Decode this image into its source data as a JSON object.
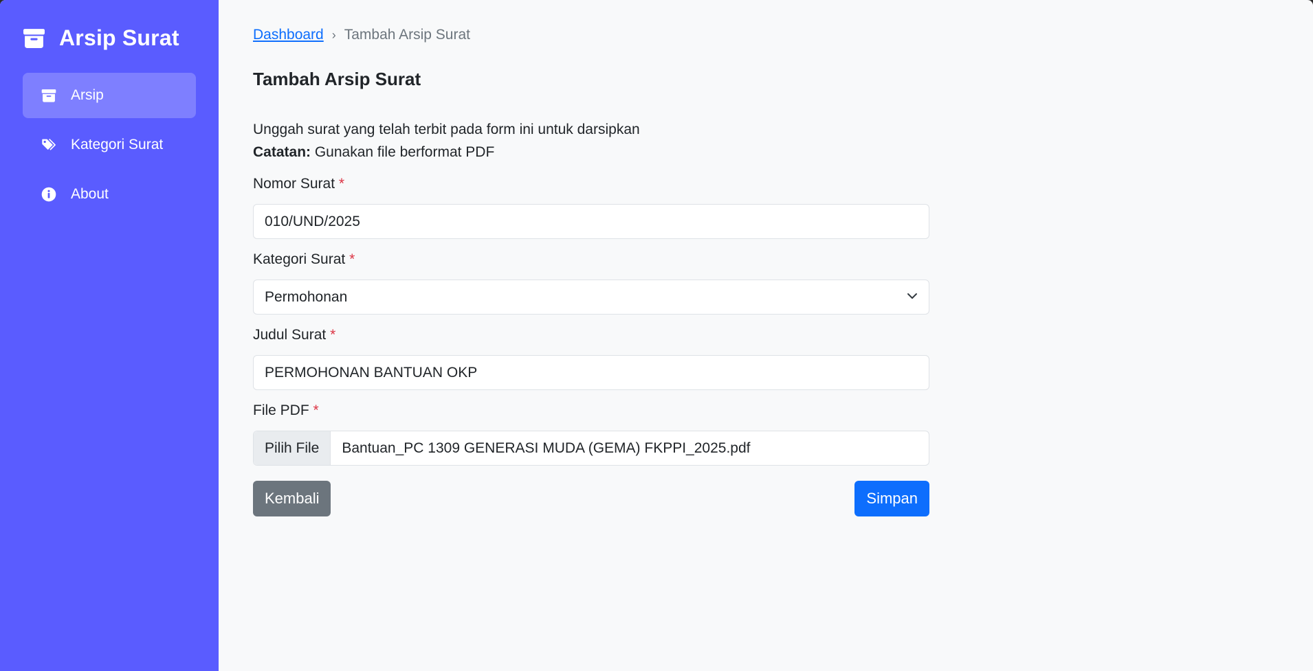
{
  "sidebar": {
    "brand": {
      "title": "Arsip Surat",
      "icon": "archive-icon"
    },
    "items": [
      {
        "label": "Arsip",
        "icon": "archive-icon",
        "active": true
      },
      {
        "label": "Kategori Surat",
        "icon": "tags-icon",
        "active": false
      },
      {
        "label": "About",
        "icon": "info-circle-icon",
        "active": false
      }
    ]
  },
  "breadcrumb": {
    "link": "Dashboard",
    "separator": "›",
    "current": "Tambah Arsip Surat"
  },
  "page": {
    "title": "Tambah Arsip Surat",
    "intro": "Unggah surat yang telah terbit pada form ini untuk darsipkan",
    "note_label": "Catatan:",
    "note_text": " Gunakan file berformat PDF"
  },
  "form": {
    "required_mark": "*",
    "nomor": {
      "label": "Nomor Surat",
      "value": "010/UND/2025"
    },
    "kategori": {
      "label": "Kategori Surat",
      "value": "Permohonan"
    },
    "judul": {
      "label": "Judul Surat",
      "value": "PERMOHONAN BANTUAN OKP"
    },
    "file": {
      "label": "File PDF",
      "button": "Pilih File",
      "filename": "Bantuan_PC 1309 GENERASI MUDA (GEMA) FKPPI_2025.pdf"
    }
  },
  "actions": {
    "back": "Kembali",
    "save": "Simpan"
  },
  "colors": {
    "sidebar": "#5a5cff",
    "primary": "#0d6efd",
    "secondary": "#6c757d",
    "required": "#dc3545"
  }
}
